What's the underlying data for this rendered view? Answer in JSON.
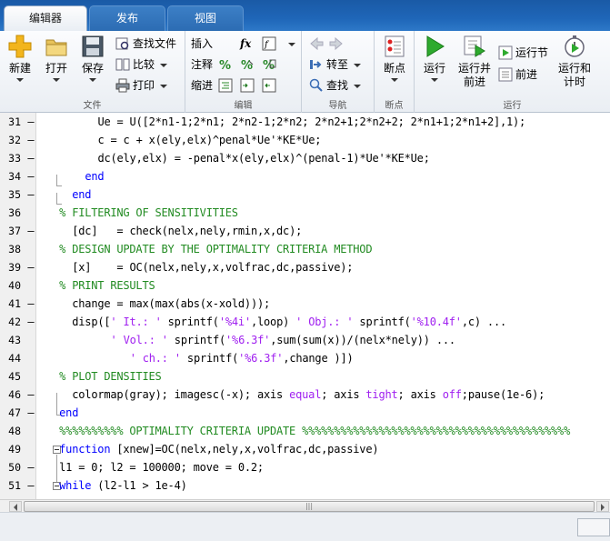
{
  "tabs": [
    {
      "label": "编辑器",
      "active": true
    },
    {
      "label": "发布",
      "active": false
    },
    {
      "label": "视图",
      "active": false
    }
  ],
  "ribbon": {
    "file": {
      "group_label": "文件",
      "new_label": "新建",
      "open_label": "打开",
      "save_label": "保存",
      "find_files_label": "查找文件",
      "compare_label": "比较",
      "print_label": "打印"
    },
    "edit": {
      "group_label": "编辑",
      "insert_label": "插入",
      "comment_label": "注释",
      "indent_label": "缩进",
      "fx_label": "fx"
    },
    "navigate": {
      "group_label": "导航",
      "goto_label": "转至",
      "find_label": "查找"
    },
    "breakpoints": {
      "group_label": "断点",
      "breakpoint_label": "断点"
    },
    "run": {
      "group_label": "运行",
      "run_label": "运行",
      "run_advance_label": "运行并",
      "run_advance_label2": "前进",
      "run_section_label": "运行节",
      "advance_label": "前进",
      "run_time_label": "运行和",
      "run_time_label2": "计时"
    },
    "colors": {
      "play_green": "#2eaa2e",
      "folder_yellow": "#e8c35a",
      "plus_yellow": "#f2b51d"
    }
  },
  "editor": {
    "lines": [
      {
        "num": "31",
        "dash": "–",
        "indent": 9,
        "parts": [
          {
            "t": "Ue = U([2*n1-1;2*n1; 2*n2-1;2*n2; 2*n2+1;2*n2+2; 2*n1+1;2*n1+2],1);",
            "c": ""
          }
        ]
      },
      {
        "num": "32",
        "dash": "–",
        "indent": 9,
        "parts": [
          {
            "t": "c = c + x(ely,elx)^penal*Ue'*KE*Ue;",
            "c": ""
          }
        ]
      },
      {
        "num": "33",
        "dash": "–",
        "indent": 9,
        "parts": [
          {
            "t": "dc(ely,elx) = -penal*x(ely,elx)^(penal-1)*Ue'*KE*Ue;",
            "c": ""
          }
        ]
      },
      {
        "num": "34",
        "dash": "–",
        "indent": 7,
        "parts": [
          {
            "t": "end",
            "c": "kw"
          }
        ]
      },
      {
        "num": "35",
        "dash": "–",
        "indent": 5,
        "parts": [
          {
            "t": "end",
            "c": "kw"
          }
        ]
      },
      {
        "num": "36",
        "dash": "",
        "indent": 3,
        "parts": [
          {
            "t": "% FILTERING OF SENSITIVITIES",
            "c": "cm"
          }
        ]
      },
      {
        "num": "37",
        "dash": "–",
        "indent": 5,
        "parts": [
          {
            "t": "[dc]   = check(nelx,nely,rmin,x,dc);",
            "c": ""
          }
        ]
      },
      {
        "num": "38",
        "dash": "",
        "indent": 3,
        "parts": [
          {
            "t": "% DESIGN UPDATE BY THE OPTIMALITY CRITERIA METHOD",
            "c": "cm"
          }
        ]
      },
      {
        "num": "39",
        "dash": "–",
        "indent": 5,
        "parts": [
          {
            "t": "[x]    = OC(nelx,nely,x,volfrac,dc,passive);",
            "c": ""
          }
        ]
      },
      {
        "num": "40",
        "dash": "",
        "indent": 3,
        "parts": [
          {
            "t": "% PRINT RESULTS",
            "c": "cm"
          }
        ]
      },
      {
        "num": "41",
        "dash": "–",
        "indent": 5,
        "parts": [
          {
            "t": "change = max(max(abs(x-xold)));",
            "c": ""
          }
        ]
      },
      {
        "num": "42",
        "dash": "–",
        "indent": 5,
        "parts": [
          {
            "t": "disp([",
            "c": ""
          },
          {
            "t": "' It.: '",
            "c": "str"
          },
          {
            "t": " sprintf(",
            "c": ""
          },
          {
            "t": "'%4i'",
            "c": "str"
          },
          {
            "t": ",loop) ",
            "c": ""
          },
          {
            "t": "' Obj.: '",
            "c": "str"
          },
          {
            "t": " sprintf(",
            "c": ""
          },
          {
            "t": "'%10.4f'",
            "c": "str"
          },
          {
            "t": ",c) ...",
            "c": ""
          }
        ]
      },
      {
        "num": "43",
        "dash": "",
        "indent": 11,
        "parts": [
          {
            "t": "' Vol.: '",
            "c": "str"
          },
          {
            "t": " sprintf(",
            "c": ""
          },
          {
            "t": "'%6.3f'",
            "c": "str"
          },
          {
            "t": ",sum(sum(x))/(nelx*nely)) ...",
            "c": ""
          }
        ]
      },
      {
        "num": "44",
        "dash": "",
        "indent": 14,
        "parts": [
          {
            "t": "' ch.: '",
            "c": "str"
          },
          {
            "t": " sprintf(",
            "c": ""
          },
          {
            "t": "'%6.3f'",
            "c": "str"
          },
          {
            "t": ",change )])",
            "c": ""
          }
        ]
      },
      {
        "num": "45",
        "dash": "",
        "indent": 3,
        "parts": [
          {
            "t": "% PLOT DENSITIES",
            "c": "cm"
          }
        ]
      },
      {
        "num": "46",
        "dash": "–",
        "indent": 5,
        "parts": [
          {
            "t": "colormap(gray); imagesc(-x); axis ",
            "c": ""
          },
          {
            "t": "equal",
            "c": "str"
          },
          {
            "t": "; axis ",
            "c": ""
          },
          {
            "t": "tight",
            "c": "str"
          },
          {
            "t": "; axis ",
            "c": ""
          },
          {
            "t": "off",
            "c": "str"
          },
          {
            "t": ";pause(1e-6);",
            "c": ""
          }
        ]
      },
      {
        "num": "47",
        "dash": "–",
        "indent": 3,
        "parts": [
          {
            "t": "end",
            "c": "kw"
          }
        ]
      },
      {
        "num": "48",
        "dash": "",
        "indent": 3,
        "parts": [
          {
            "t": "%%%%%%%%%% OPTIMALITY CRITERIA UPDATE %%%%%%%%%%%%%%%%%%%%%%%%%%%%%%%%%%%%%%%%%%",
            "c": "cm"
          }
        ]
      },
      {
        "num": "49",
        "dash": "",
        "indent": 3,
        "parts": [
          {
            "t": "function",
            "c": "kw"
          },
          {
            "t": " [xnew]=OC(nelx,nely,x,volfrac,dc,passive)",
            "c": ""
          }
        ]
      },
      {
        "num": "50",
        "dash": "–",
        "indent": 3,
        "parts": [
          {
            "t": "l1 = 0; l2 = 100000; move = 0.2;",
            "c": ""
          }
        ]
      },
      {
        "num": "51",
        "dash": "–",
        "indent": 3,
        "parts": [
          {
            "t": "while",
            "c": "kw"
          },
          {
            "t": " (l2-l1 > 1e-4)",
            "c": ""
          }
        ]
      }
    ]
  },
  "scrollbar": {
    "grip": "|||"
  }
}
